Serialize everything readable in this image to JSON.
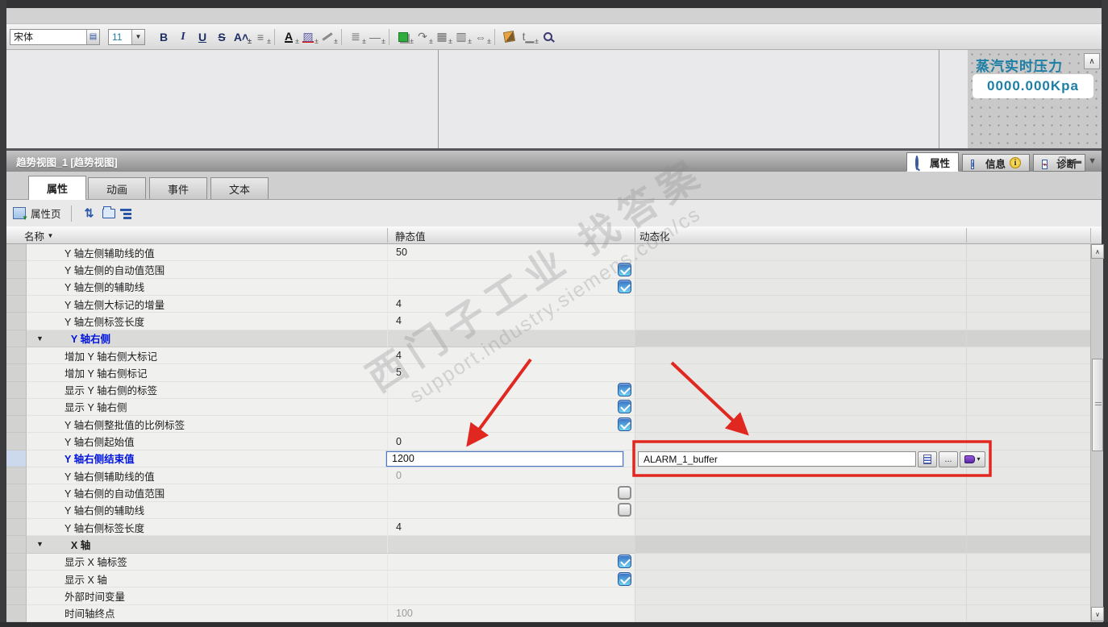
{
  "format_toolbar": {
    "font_name": "宋体",
    "font_size": "11",
    "icons": [
      "bold",
      "italic",
      "underline",
      "strikethrough",
      "font-size-inc",
      "justify",
      "font-color",
      "highlight",
      "pen-color",
      "line-style",
      "line-weight",
      "fill-color",
      "rotate",
      "align-objects",
      "distribute",
      "same-size",
      "brush",
      "tab-order",
      "zoom-select"
    ]
  },
  "canvas": {
    "steam_label": "蒸汽实时压力",
    "steam_value": "0000.000Kpa"
  },
  "panel": {
    "title": "趋势视图_1 [趋势视图]",
    "right_tabs": [
      {
        "label": "属性",
        "active": true
      },
      {
        "label": "信息",
        "active": false
      },
      {
        "label": "诊断",
        "active": false
      }
    ],
    "tabs": [
      {
        "label": "属性",
        "active": true
      },
      {
        "label": "动画",
        "active": false
      },
      {
        "label": "事件",
        "active": false
      },
      {
        "label": "文本",
        "active": false
      }
    ],
    "prop_toolbar": {
      "page_label": "属性页"
    },
    "grid": {
      "headers": {
        "name": "名称",
        "sort": "▼",
        "static": "静态值",
        "dyn": "动态化"
      },
      "rows": [
        {
          "name": "Y 轴左侧辅助线的值",
          "static_type": "text",
          "static_value": "50"
        },
        {
          "name": "Y 轴左侧的自动值范围",
          "static_type": "checkbox",
          "checked": true
        },
        {
          "name": "Y 轴左侧的辅助线",
          "static_type": "checkbox",
          "checked": true
        },
        {
          "name": "Y 轴左侧大标记的增量",
          "static_type": "text",
          "static_value": "4"
        },
        {
          "name": "Y 轴左侧标签长度",
          "static_type": "text",
          "static_value": "4"
        },
        {
          "name": "Y 轴右侧",
          "group": true,
          "blue": true
        },
        {
          "name": "增加 Y 轴右侧大标记",
          "static_type": "text",
          "static_value": "4"
        },
        {
          "name": "增加 Y 轴右侧标记",
          "static_type": "text",
          "static_value": "5"
        },
        {
          "name": "显示 Y 轴右侧的标签",
          "static_type": "checkbox",
          "checked": true
        },
        {
          "name": "显示 Y 轴右侧",
          "static_type": "checkbox",
          "checked": true
        },
        {
          "name": "Y 轴右侧整批值的比例标签",
          "static_type": "checkbox",
          "checked": true
        },
        {
          "name": "Y 轴右侧起始值",
          "static_type": "text",
          "static_value": "0"
        },
        {
          "name": "Y 轴右侧结束值",
          "selected": true,
          "static_type": "input",
          "static_value": "1200",
          "dyn_type": "taginput",
          "dyn_value": "ALARM_1_buffer"
        },
        {
          "name": "Y 轴右侧辅助线的值",
          "static_type": "text",
          "static_value": "0",
          "muted": true
        },
        {
          "name": "Y 轴右侧的自动值范围",
          "static_type": "checkbox",
          "checked": false
        },
        {
          "name": "Y 轴右侧的辅助线",
          "static_type": "checkbox",
          "checked": false
        },
        {
          "name": "Y 轴右侧标签长度",
          "static_type": "text",
          "static_value": "4"
        },
        {
          "name": "X 轴",
          "group": true,
          "blue": false
        },
        {
          "name": "显示 X 轴标签",
          "static_type": "checkbox",
          "checked": true
        },
        {
          "name": "显示 X 轴",
          "static_type": "checkbox",
          "checked": true
        },
        {
          "name": "外部时间变量",
          "static_type": "none"
        },
        {
          "name": "时间轴终点",
          "static_type": "text",
          "static_value": "100",
          "muted": true
        }
      ],
      "tag_row_buttons": {
        "more": "...",
        "dropdown": "▾"
      }
    }
  },
  "watermark": {
    "line1": "西门子工业 找答案",
    "line2": "support.industry.siemens.com/cs"
  },
  "colors": {
    "annotation_red": "#e02820",
    "selected_blue": "#0014e0",
    "teal": "#1d7fa6",
    "checkbox_blue": "#3a6fc2"
  }
}
